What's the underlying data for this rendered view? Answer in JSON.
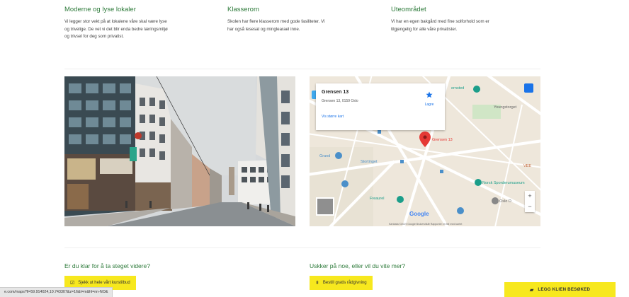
{
  "features": [
    {
      "title": "Moderne og lyse lokaler",
      "lines": [
        "Vi legger stor vekt på at lokalene våre skal være lyse",
        "og trivelige. De vet vi det blir enda bedre læringsmiljø",
        "og trivsel for deg som privatist."
      ]
    },
    {
      "title": "Klasserom",
      "lines": [
        "Skolen har flere klasserom med gode fasiliteter. Vi",
        "har også lesesal og minglearael inne."
      ]
    },
    {
      "title": "Uteområdet",
      "lines": [
        "Vi har en egen bakgård med fine solforhold som er",
        "tilgjengelig for alle våre privatister."
      ]
    }
  ],
  "map": {
    "place_name": "Grensen 13",
    "address": "Grensen 13, 0159 Oslo",
    "directions_label": "Lagre",
    "larger_map_label": "Vis større kart",
    "pin_label": "Grensen 13",
    "labels": [
      {
        "text": "Youngstorget",
        "color": "#666666"
      },
      {
        "text": "Grand",
        "color": "#4a8fc9"
      },
      {
        "text": "Stortinget",
        "color": "#4a8fc9"
      },
      {
        "text": "Norsk Sporderumuseum",
        "color": "#1b9e8a"
      },
      {
        "text": "Freaurel",
        "color": "#1b9e8a"
      },
      {
        "text": "Oslo D",
        "color": "#666666"
      },
      {
        "text": "VEE",
        "color": "#c06030"
      },
      {
        "text": "ernsted",
        "color": "#1b9e8a"
      }
    ],
    "google_logo": "Google",
    "footer": "Kartdata ©2019 Google    Brukervilkår    Rapporter en feil med kartet",
    "zoom_in": "+",
    "zoom_out": "−"
  },
  "cta": {
    "left_heading": "Er du klar for å ta steget videre?",
    "left_button": "Sjekk ut hele vårt kurstilbud",
    "right_heading": "Uskker på noe, eller vil du vite mer?",
    "right_button": "Bestill gratis rådgivning"
  },
  "float_button": "LEGG KLIEN BESØKED",
  "status_url": "e.com/maps?ll=59.914024,10.743307&z=16&t=m&hl=nn-NO&",
  "colors": {
    "accent_green": "#2d7a3a",
    "button_yellow": "#f7e81e",
    "map_pin": "#e53935"
  }
}
